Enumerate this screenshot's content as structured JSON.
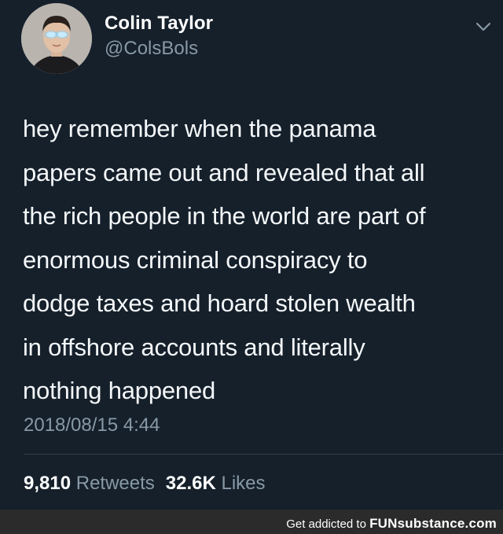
{
  "tweet": {
    "display_name": "Colin Taylor",
    "handle": "@ColsBols",
    "text": "hey remember when the panama\npapers came out and revealed that all\nthe rich people in the world are part of\nenormous criminal conspiracy to\ndodge taxes and hoard stolen wealth\nin offshore accounts and literally\nnothing happened",
    "timestamp": "2018/08/15 4:44",
    "retweets_count": "9,810",
    "retweets_label": "Retweets",
    "likes_count": "32.6K",
    "likes_label": "Likes"
  },
  "footer": {
    "prefix": "Get addicted to",
    "brand": "FUNsubstance.com"
  },
  "colors": {
    "background": "#15202b",
    "text_primary": "#ffffff",
    "text_secondary": "#8899a6",
    "footer_bg": "#2b2b2b"
  },
  "icons": {
    "menu": "chevron-down-icon",
    "avatar": "avatar"
  }
}
